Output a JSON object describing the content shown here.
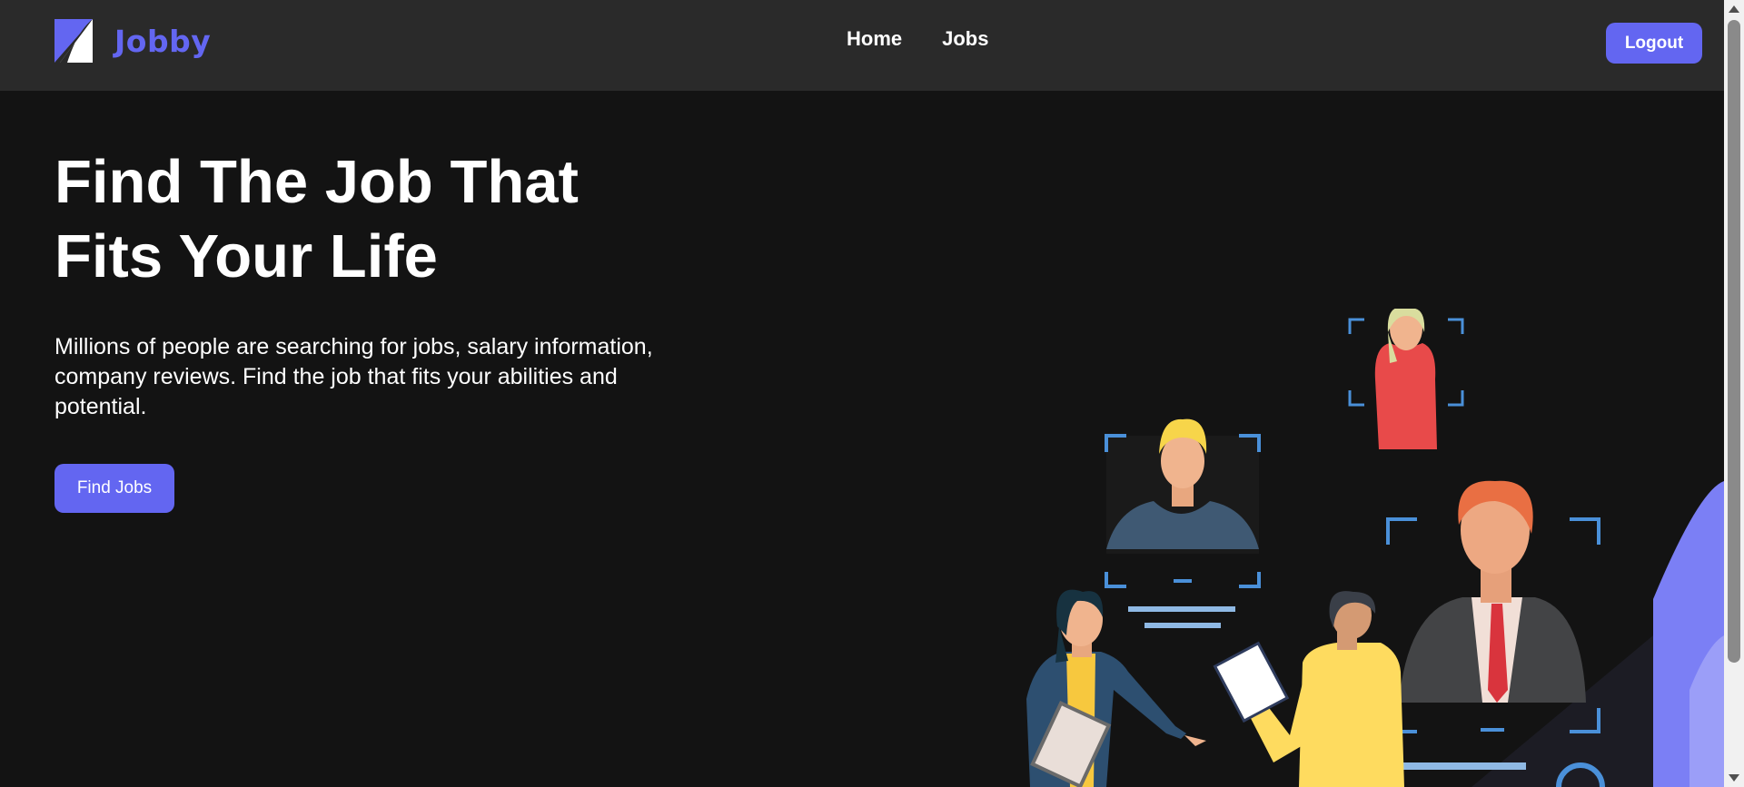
{
  "app": {
    "logo_text": "Jobby"
  },
  "nav": {
    "links": [
      "Home",
      "Jobs"
    ],
    "logout_label": "Logout"
  },
  "hero": {
    "title_line1": "Find The Job That",
    "title_line2": "Fits Your Life",
    "description": "Millions of people are searching for jobs, salary information, company reviews. Find the job that fits your abilities and potential.",
    "button_label": "Find Jobs"
  },
  "colors": {
    "accent": "#6366f1",
    "header_bg": "#2a2a2a",
    "page_bg": "#131313"
  }
}
